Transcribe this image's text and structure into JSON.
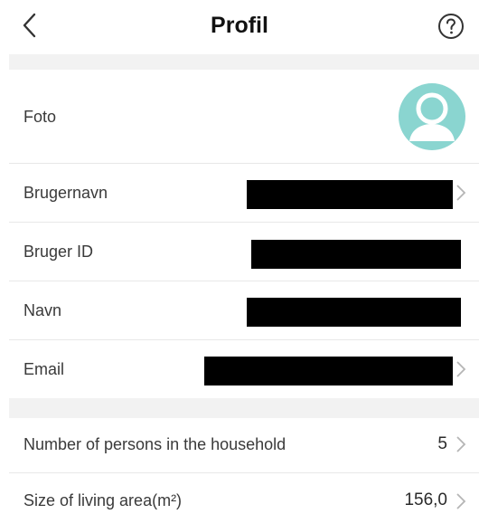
{
  "header": {
    "title": "Profil",
    "back_icon": "chevron-left-icon",
    "help_icon": "question-circle-icon"
  },
  "rows": [
    {
      "label": "Foto"
    },
    {
      "label": "Brugernavn"
    },
    {
      "label": "Bruger ID"
    },
    {
      "label": "Navn"
    },
    {
      "label": "Email"
    },
    {
      "label": "Number of persons in the household",
      "value": "5"
    },
    {
      "label": "Size of living area(m²)",
      "value": "156,0"
    }
  ],
  "colors": {
    "avatar": "#8ad5d0",
    "section_band": "#f2f2f2",
    "redaction": "#000000"
  }
}
